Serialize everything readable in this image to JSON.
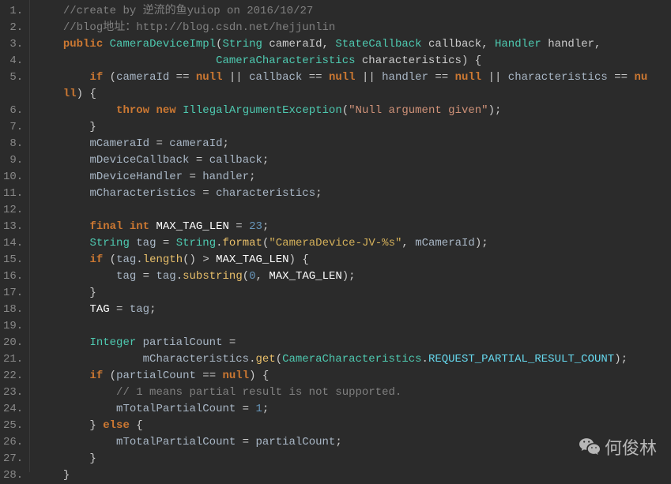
{
  "lines": [
    {
      "n": "1.",
      "tokens": [
        [
          "    ",
          ""
        ],
        [
          "//create by 逆流的鱼yuiop on 2016/10/27",
          "comment"
        ]
      ]
    },
    {
      "n": "2.",
      "tokens": [
        [
          "    ",
          ""
        ],
        [
          "//blog地址：http://blog.csdn.net/hejjunlin",
          "comment"
        ]
      ]
    },
    {
      "n": "3.",
      "tokens": [
        [
          "    ",
          ""
        ],
        [
          "public",
          "keyword"
        ],
        [
          " ",
          ""
        ],
        [
          "CameraDeviceImpl",
          "methodgreen"
        ],
        [
          "(",
          "paren"
        ],
        [
          "String",
          "classname"
        ],
        [
          " ",
          ""
        ],
        [
          "cameraId",
          "param"
        ],
        [
          ", ",
          ""
        ],
        [
          "StateCallback",
          "classname"
        ],
        [
          " ",
          ""
        ],
        [
          "callback",
          "param"
        ],
        [
          ", ",
          ""
        ],
        [
          "Handler",
          "classname"
        ],
        [
          " ",
          ""
        ],
        [
          "handler",
          "param"
        ],
        [
          ",",
          ""
        ]
      ]
    },
    {
      "n": "4.",
      "tokens": [
        [
          "                           ",
          ""
        ],
        [
          "CameraCharacteristics",
          "classname"
        ],
        [
          " ",
          ""
        ],
        [
          "characteristics",
          "param"
        ],
        [
          ") {",
          "paren"
        ]
      ]
    },
    {
      "n": "5.",
      "tokens": [
        [
          "        ",
          ""
        ],
        [
          "if",
          "keyword"
        ],
        [
          " (",
          "paren"
        ],
        [
          "cameraId",
          "ident"
        ],
        [
          " == ",
          "op"
        ],
        [
          "null",
          "keyword"
        ],
        [
          " || ",
          "op"
        ],
        [
          "callback",
          "ident"
        ],
        [
          " == ",
          "op"
        ],
        [
          "null",
          "keyword"
        ],
        [
          " || ",
          "op"
        ],
        [
          "handler",
          "ident"
        ],
        [
          " == ",
          "op"
        ],
        [
          "null",
          "keyword"
        ],
        [
          " || ",
          "op"
        ],
        [
          "characteristics",
          "ident"
        ],
        [
          " == ",
          "op"
        ],
        [
          "nu",
          "keyword"
        ]
      ]
    },
    {
      "n": "",
      "tokens": [
        [
          "    ",
          ""
        ],
        [
          "ll",
          "keyword"
        ],
        [
          ") {",
          "paren"
        ]
      ]
    },
    {
      "n": "6.",
      "tokens": [
        [
          "            ",
          ""
        ],
        [
          "throw",
          "keyword"
        ],
        [
          " ",
          ""
        ],
        [
          "new",
          "keyword"
        ],
        [
          " ",
          ""
        ],
        [
          "IllegalArgumentException",
          "classname"
        ],
        [
          "(",
          "paren"
        ],
        [
          "\"Null argument given\"",
          "stringalt"
        ],
        [
          ");",
          "paren"
        ]
      ]
    },
    {
      "n": "7.",
      "tokens": [
        [
          "        }",
          "paren"
        ]
      ]
    },
    {
      "n": "8.",
      "tokens": [
        [
          "        ",
          ""
        ],
        [
          "mCameraId",
          "field"
        ],
        [
          " = ",
          "op"
        ],
        [
          "cameraId",
          "ident"
        ],
        [
          ";",
          ""
        ]
      ]
    },
    {
      "n": "9.",
      "tokens": [
        [
          "        ",
          ""
        ],
        [
          "mDeviceCallback",
          "field"
        ],
        [
          " = ",
          "op"
        ],
        [
          "callback",
          "ident"
        ],
        [
          ";",
          ""
        ]
      ]
    },
    {
      "n": "10.",
      "tokens": [
        [
          "        ",
          ""
        ],
        [
          "mDeviceHandler",
          "field"
        ],
        [
          " = ",
          "op"
        ],
        [
          "handler",
          "ident"
        ],
        [
          ";",
          ""
        ]
      ]
    },
    {
      "n": "11.",
      "tokens": [
        [
          "        ",
          ""
        ],
        [
          "mCharacteristics",
          "field"
        ],
        [
          " = ",
          "op"
        ],
        [
          "characteristics",
          "ident"
        ],
        [
          ";",
          ""
        ]
      ]
    },
    {
      "n": "12.",
      "tokens": [
        [
          "",
          ""
        ]
      ]
    },
    {
      "n": "13.",
      "tokens": [
        [
          "        ",
          ""
        ],
        [
          "final",
          "keyword"
        ],
        [
          " ",
          ""
        ],
        [
          "int",
          "keyword"
        ],
        [
          " ",
          ""
        ],
        [
          "MAX_TAG_LEN",
          "white"
        ],
        [
          " = ",
          "op"
        ],
        [
          "23",
          "number"
        ],
        [
          ";",
          ""
        ]
      ]
    },
    {
      "n": "14.",
      "tokens": [
        [
          "        ",
          ""
        ],
        [
          "String",
          "classname"
        ],
        [
          " ",
          ""
        ],
        [
          "tag",
          "ident"
        ],
        [
          " = ",
          "op"
        ],
        [
          "String",
          "classname"
        ],
        [
          ".",
          ""
        ],
        [
          "format",
          "method"
        ],
        [
          "(",
          "paren"
        ],
        [
          "\"CameraDevice-JV-%s\"",
          "stringyel"
        ],
        [
          ", ",
          ""
        ],
        [
          "mCameraId",
          "field"
        ],
        [
          ");",
          "paren"
        ]
      ]
    },
    {
      "n": "15.",
      "tokens": [
        [
          "        ",
          ""
        ],
        [
          "if",
          "keyword"
        ],
        [
          " (",
          "paren"
        ],
        [
          "tag",
          "ident"
        ],
        [
          ".",
          ""
        ],
        [
          "length",
          "method"
        ],
        [
          "() > ",
          "op"
        ],
        [
          "MAX_TAG_LEN",
          "white"
        ],
        [
          ") {",
          "paren"
        ]
      ]
    },
    {
      "n": "16.",
      "tokens": [
        [
          "            ",
          ""
        ],
        [
          "tag",
          "ident"
        ],
        [
          " = ",
          "op"
        ],
        [
          "tag",
          "ident"
        ],
        [
          ".",
          ""
        ],
        [
          "substring",
          "method"
        ],
        [
          "(",
          "paren"
        ],
        [
          "0",
          "number"
        ],
        [
          ", ",
          ""
        ],
        [
          "MAX_TAG_LEN",
          "white"
        ],
        [
          ");",
          "paren"
        ]
      ]
    },
    {
      "n": "17.",
      "tokens": [
        [
          "        }",
          "paren"
        ]
      ]
    },
    {
      "n": "18.",
      "tokens": [
        [
          "        ",
          ""
        ],
        [
          "TAG",
          "white"
        ],
        [
          " = ",
          "op"
        ],
        [
          "tag",
          "ident"
        ],
        [
          ";",
          ""
        ]
      ]
    },
    {
      "n": "19.",
      "tokens": [
        [
          "",
          ""
        ]
      ]
    },
    {
      "n": "20.",
      "tokens": [
        [
          "        ",
          ""
        ],
        [
          "Integer",
          "classname"
        ],
        [
          " ",
          ""
        ],
        [
          "partialCount",
          "ident"
        ],
        [
          " =",
          "op"
        ]
      ]
    },
    {
      "n": "21.",
      "tokens": [
        [
          "                ",
          ""
        ],
        [
          "mCharacteristics",
          "field"
        ],
        [
          ".",
          ""
        ],
        [
          "get",
          "method"
        ],
        [
          "(",
          "paren"
        ],
        [
          "CameraCharacteristics",
          "classname"
        ],
        [
          ".",
          ""
        ],
        [
          "REQUEST_PARTIAL_RESULT_COUNT",
          "constblue"
        ],
        [
          ");",
          "paren"
        ]
      ]
    },
    {
      "n": "22.",
      "tokens": [
        [
          "        ",
          ""
        ],
        [
          "if",
          "keyword"
        ],
        [
          " (",
          "paren"
        ],
        [
          "partialCount",
          "ident"
        ],
        [
          " == ",
          "op"
        ],
        [
          "null",
          "keyword"
        ],
        [
          ") {",
          "paren"
        ]
      ]
    },
    {
      "n": "23.",
      "tokens": [
        [
          "            ",
          ""
        ],
        [
          "// 1 means partial result is not supported.",
          "comment"
        ]
      ]
    },
    {
      "n": "24.",
      "tokens": [
        [
          "            ",
          ""
        ],
        [
          "mTotalPartialCount",
          "field"
        ],
        [
          " = ",
          "op"
        ],
        [
          "1",
          "number"
        ],
        [
          ";",
          ""
        ]
      ]
    },
    {
      "n": "25.",
      "tokens": [
        [
          "        } ",
          "paren"
        ],
        [
          "else",
          "keyword"
        ],
        [
          " {",
          "paren"
        ]
      ]
    },
    {
      "n": "26.",
      "tokens": [
        [
          "            ",
          ""
        ],
        [
          "mTotalPartialCount",
          "field"
        ],
        [
          " = ",
          "op"
        ],
        [
          "partialCount",
          "ident"
        ],
        [
          ";",
          ""
        ]
      ]
    },
    {
      "n": "27.",
      "tokens": [
        [
          "        }",
          "paren"
        ]
      ]
    },
    {
      "n": "28.",
      "tokens": [
        [
          "    }",
          "paren"
        ]
      ]
    }
  ],
  "watermark": {
    "text": "何俊林"
  }
}
